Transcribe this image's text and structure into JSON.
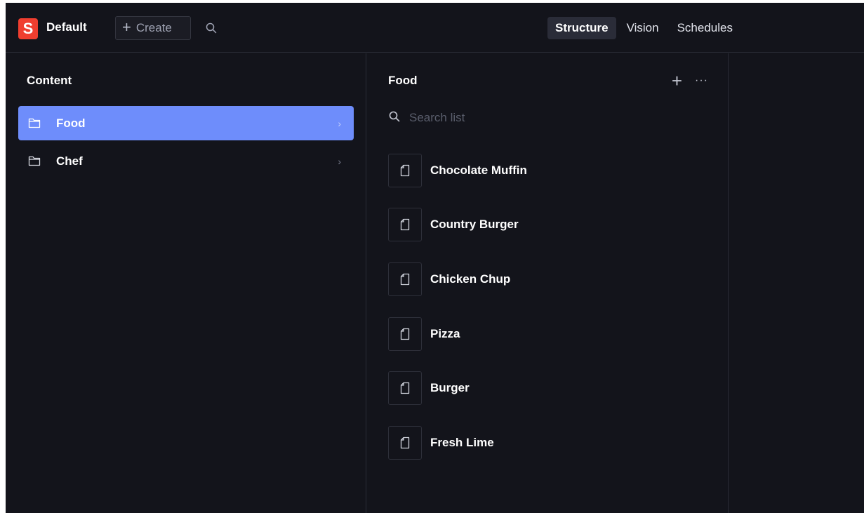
{
  "header": {
    "logo_letter": "S",
    "workspace": "Default",
    "create_label": "Create",
    "tabs": [
      {
        "label": "Structure",
        "active": true
      },
      {
        "label": "Vision",
        "active": false
      },
      {
        "label": "Schedules",
        "active": false
      }
    ]
  },
  "content_pane": {
    "title": "Content",
    "items": [
      {
        "label": "Food",
        "selected": true
      },
      {
        "label": "Chef",
        "selected": false
      }
    ]
  },
  "list_pane": {
    "title": "Food",
    "search_placeholder": "Search list",
    "items": [
      {
        "label": "Chocolate Muffin"
      },
      {
        "label": "Country Burger"
      },
      {
        "label": "Chicken Chup"
      },
      {
        "label": "Pizza"
      },
      {
        "label": "Burger"
      },
      {
        "label": "Fresh Lime"
      }
    ]
  },
  "colors": {
    "background": "#13141b",
    "accent_selected": "#6e8dfb",
    "logo": "#f03e2f"
  }
}
